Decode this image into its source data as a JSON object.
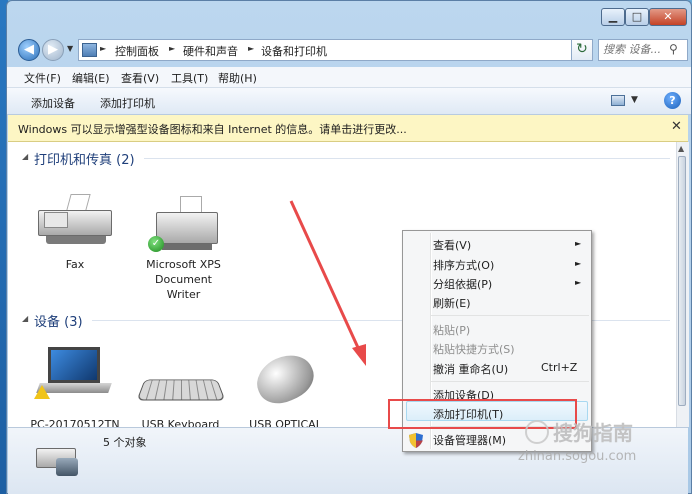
{
  "window": {
    "caption_min": "▁",
    "caption_max": "□",
    "caption_close": "✕"
  },
  "address": {
    "crumbs": [
      "控制面板",
      "硬件和声音",
      "设备和打印机"
    ],
    "search_placeholder": "搜索 设备..."
  },
  "menubar": [
    "文件(F)",
    "编辑(E)",
    "查看(V)",
    "工具(T)",
    "帮助(H)"
  ],
  "toolbar": {
    "add_device": "添加设备",
    "add_printer": "添加打印机",
    "help": "?"
  },
  "infobar": {
    "text": "Windows 可以显示增强型设备图标和来自 Internet 的信息。请单击进行更改...",
    "close": "✕"
  },
  "groups": {
    "printers": {
      "title": "打印机和传真 (2)",
      "items": [
        {
          "label": "Fax"
        },
        {
          "label_lines": [
            "Microsoft XPS",
            "Document",
            "Writer"
          ]
        }
      ]
    },
    "devices": {
      "title": "设备 (3)",
      "items": [
        {
          "label": "PC-20170512TN"
        },
        {
          "label": "USB Keyboard"
        },
        {
          "label": "USB OPTICAL"
        }
      ]
    }
  },
  "status": {
    "text": "5 个对象"
  },
  "context_menu": {
    "items": [
      {
        "label": "查看(V)",
        "submenu": true
      },
      {
        "label": "排序方式(O)",
        "submenu": true
      },
      {
        "label": "分组依据(P)",
        "submenu": true
      },
      {
        "label": "刷新(E)"
      },
      {
        "label": "粘贴(P)",
        "disabled": true
      },
      {
        "label": "粘贴快捷方式(S)",
        "disabled": true
      },
      {
        "label": "撤消 重命名(U)",
        "shortcut": "Ctrl+Z"
      },
      {
        "label": "添加设备(D)"
      },
      {
        "label": "添加打印机(T)",
        "highlighted": true
      },
      {
        "label": "设备管理器(M)"
      }
    ],
    "submenu_arrow": "►"
  },
  "watermark": {
    "main": "搜狗指南",
    "sub": "zhinan.sogou.com"
  },
  "colors": {
    "annotation_red": "#e84a4a",
    "highlight": "#dbeefa",
    "group_title": "#1f3f7a"
  }
}
